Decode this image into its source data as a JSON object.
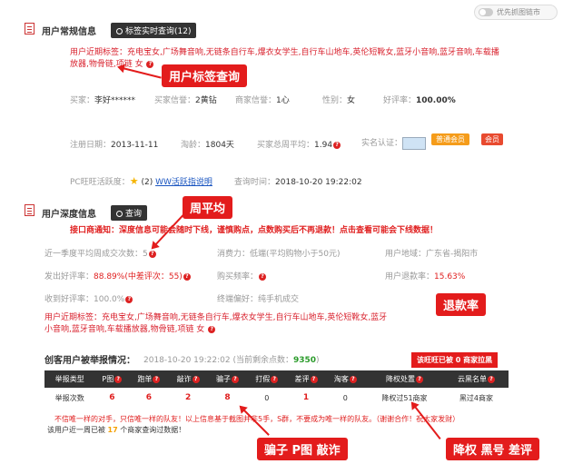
{
  "top": {
    "btn_label": "优先抓图链市"
  },
  "basic": {
    "title": "用户常规信息",
    "tag_btn": "标签实时查询(12)",
    "tags_label": "用户近期标签：",
    "tags_text": "充电宝女,广场舞音响,无链条自行车,爆衣女学生,自行车山地车,英伦短靴女,蓝牙小音响,蓝牙音响,车载播放器,物骨链,项链 女",
    "buyer_label": "买家：",
    "buyer_value": "李好******",
    "buyer_credit_label": "买家信誉：",
    "buyer_credit_value": "2黄钻",
    "seller_credit_label": "商家信誉：",
    "seller_credit_value": "1心",
    "gender_label": "性别：",
    "gender_value": "女",
    "good_rate_label": "好评率：",
    "good_rate_value": "100.00%",
    "reg_label": "注册日期：",
    "reg_value": "2013-11-11",
    "age_label": "淘龄：",
    "age_value": "1804天",
    "avg_label": "买家总周平均：",
    "avg_value": "1.94",
    "auth_label": "实名认证：",
    "vip_label": "普通会员",
    "member_label": "会员",
    "pc_label": "PC旺旺活跃度：",
    "pc_count": "(2)",
    "pc_link": "WW活跃指说明",
    "query_time_label": "查询时间：",
    "query_time_value": "2018-10-20 19:22:02"
  },
  "deep": {
    "title": "用户深度信息",
    "query_btn": "查询",
    "notice": "接口商通知：深度信息可能会随时下线，谨慎购点，点数购买后不再退款！点击查看可能会下线数据！",
    "weekly_label": "近一季度平均周成交次数：",
    "weekly_value": "5",
    "consume_label": "消费力：",
    "consume_value": "低端(平均购物小于50元)",
    "region_label": "用户地域：",
    "region_value": "广东省-揭阳市",
    "ship_label": "发出好评率：",
    "ship_value": "88.89%(中差评次：55)",
    "shop_label": "购买频率：",
    "shop_value": "",
    "refund_label": "用户退款率：",
    "refund_value": "15.63%",
    "recv_label": "收到好评率：",
    "recv_value": "100.0%",
    "pref_label": "终端偏好：",
    "pref_value": "纯手机成交",
    "tags_label": "用户近期标签：",
    "tags_text": "充电宝女,广场舞音响,无链条自行车,爆衣女学生,自行车山地车,英伦短靴女,蓝牙小音响,蓝牙音响,车载播放器,物骨链,项链 女"
  },
  "report": {
    "title": "创客用户被举报情况：",
    "time": "2018-10-20 19:22:02",
    "points_label": "(当前剩余点数：",
    "points_value": "9350",
    "points_suffix": ")",
    "banner": "该旺旺已被 0 商家拉黑",
    "headers": [
      "举报类型",
      "P图",
      "跑单",
      "敲诈",
      "骗子",
      "打假",
      "差评",
      "淘客",
      "降权处置",
      "云黑名单"
    ],
    "row": [
      "举报次数",
      "6",
      "6",
      "2",
      "8",
      "0",
      "1",
      "0",
      "降权过51商家",
      "黑过4商家"
    ],
    "footer1": "不信唯一样的对手，只信唯一样的队友！以上信息基于截图并非5手，S群，不要成为唯一样的队友。（谢谢合作！祝大家发财）",
    "footer2_prefix": "该用户近一周已被",
    "footer2_count": "17",
    "footer2_suffix": "个商家查询过数据！"
  },
  "callouts": {
    "tag_query": "用户标签查询",
    "weekly_avg": "周平均",
    "refund_rate": "退款率",
    "scam": "骗子 P图 敲诈",
    "downgrade": "降权 黑号 差评"
  },
  "colors": {
    "accent_red": "#e31c1c",
    "dark": "#333333"
  }
}
